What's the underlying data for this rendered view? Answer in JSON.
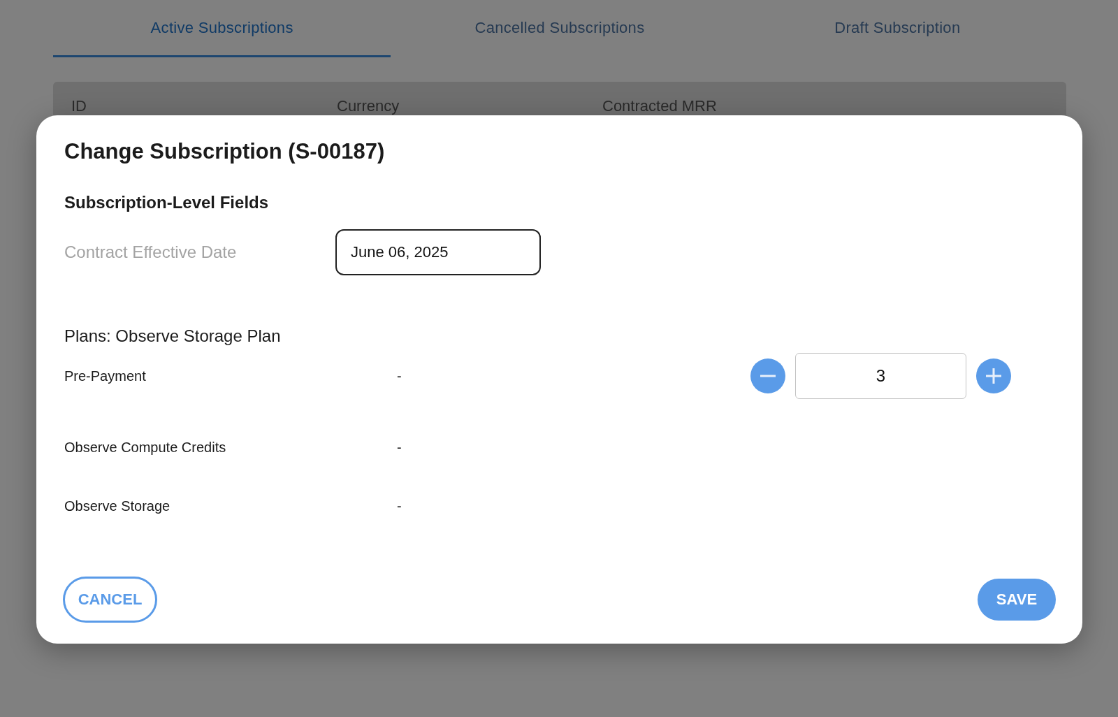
{
  "tabs": [
    {
      "label": "Active Subscriptions",
      "selected": true
    },
    {
      "label": "Cancelled Subscriptions",
      "selected": false
    },
    {
      "label": "Draft Subscription",
      "selected": false
    }
  ],
  "table": {
    "columns": [
      "ID",
      "Currency",
      "Contracted MRR"
    ]
  },
  "dialog": {
    "title": "Change Subscription (S-00187)",
    "section_title": "Subscription-Level Fields",
    "fields": [
      {
        "label": "Contract Effective Date",
        "value": "June 06, 2025"
      }
    ],
    "plan_title": "Plans: Observe Storage Plan",
    "items": [
      {
        "kind": "stepper",
        "name": "Pre-Payment",
        "value": "-",
        "quantity": "3"
      },
      {
        "kind": "plain",
        "name": "Observe Compute Credits",
        "value": "-"
      },
      {
        "kind": "plain",
        "name": "Observe Storage",
        "value": "-"
      }
    ],
    "buttons": {
      "cancel": "CANCEL",
      "save": "SAVE"
    }
  }
}
